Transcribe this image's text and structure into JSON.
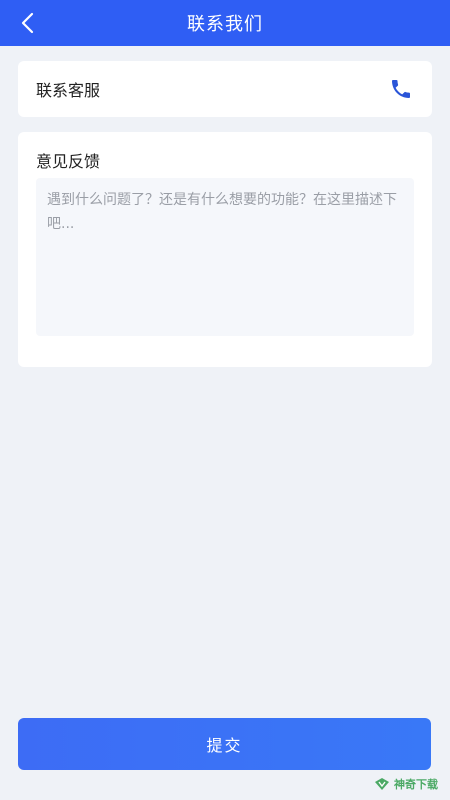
{
  "header": {
    "title": "联系我们"
  },
  "contact": {
    "label": "联系客服"
  },
  "feedback": {
    "title": "意见反馈",
    "placeholder": "遇到什么问题了？还是有什么想要的功能？在这里描述下吧...",
    "value": ""
  },
  "submit": {
    "label": "提交"
  },
  "watermark": {
    "text": "神奇下载"
  },
  "colors": {
    "primary": "#2f5ef4",
    "page_bg": "#eff2f7",
    "phone_icon": "#2a55d8"
  },
  "icons": {
    "back": "chevron-left-icon",
    "phone": "phone-icon"
  }
}
